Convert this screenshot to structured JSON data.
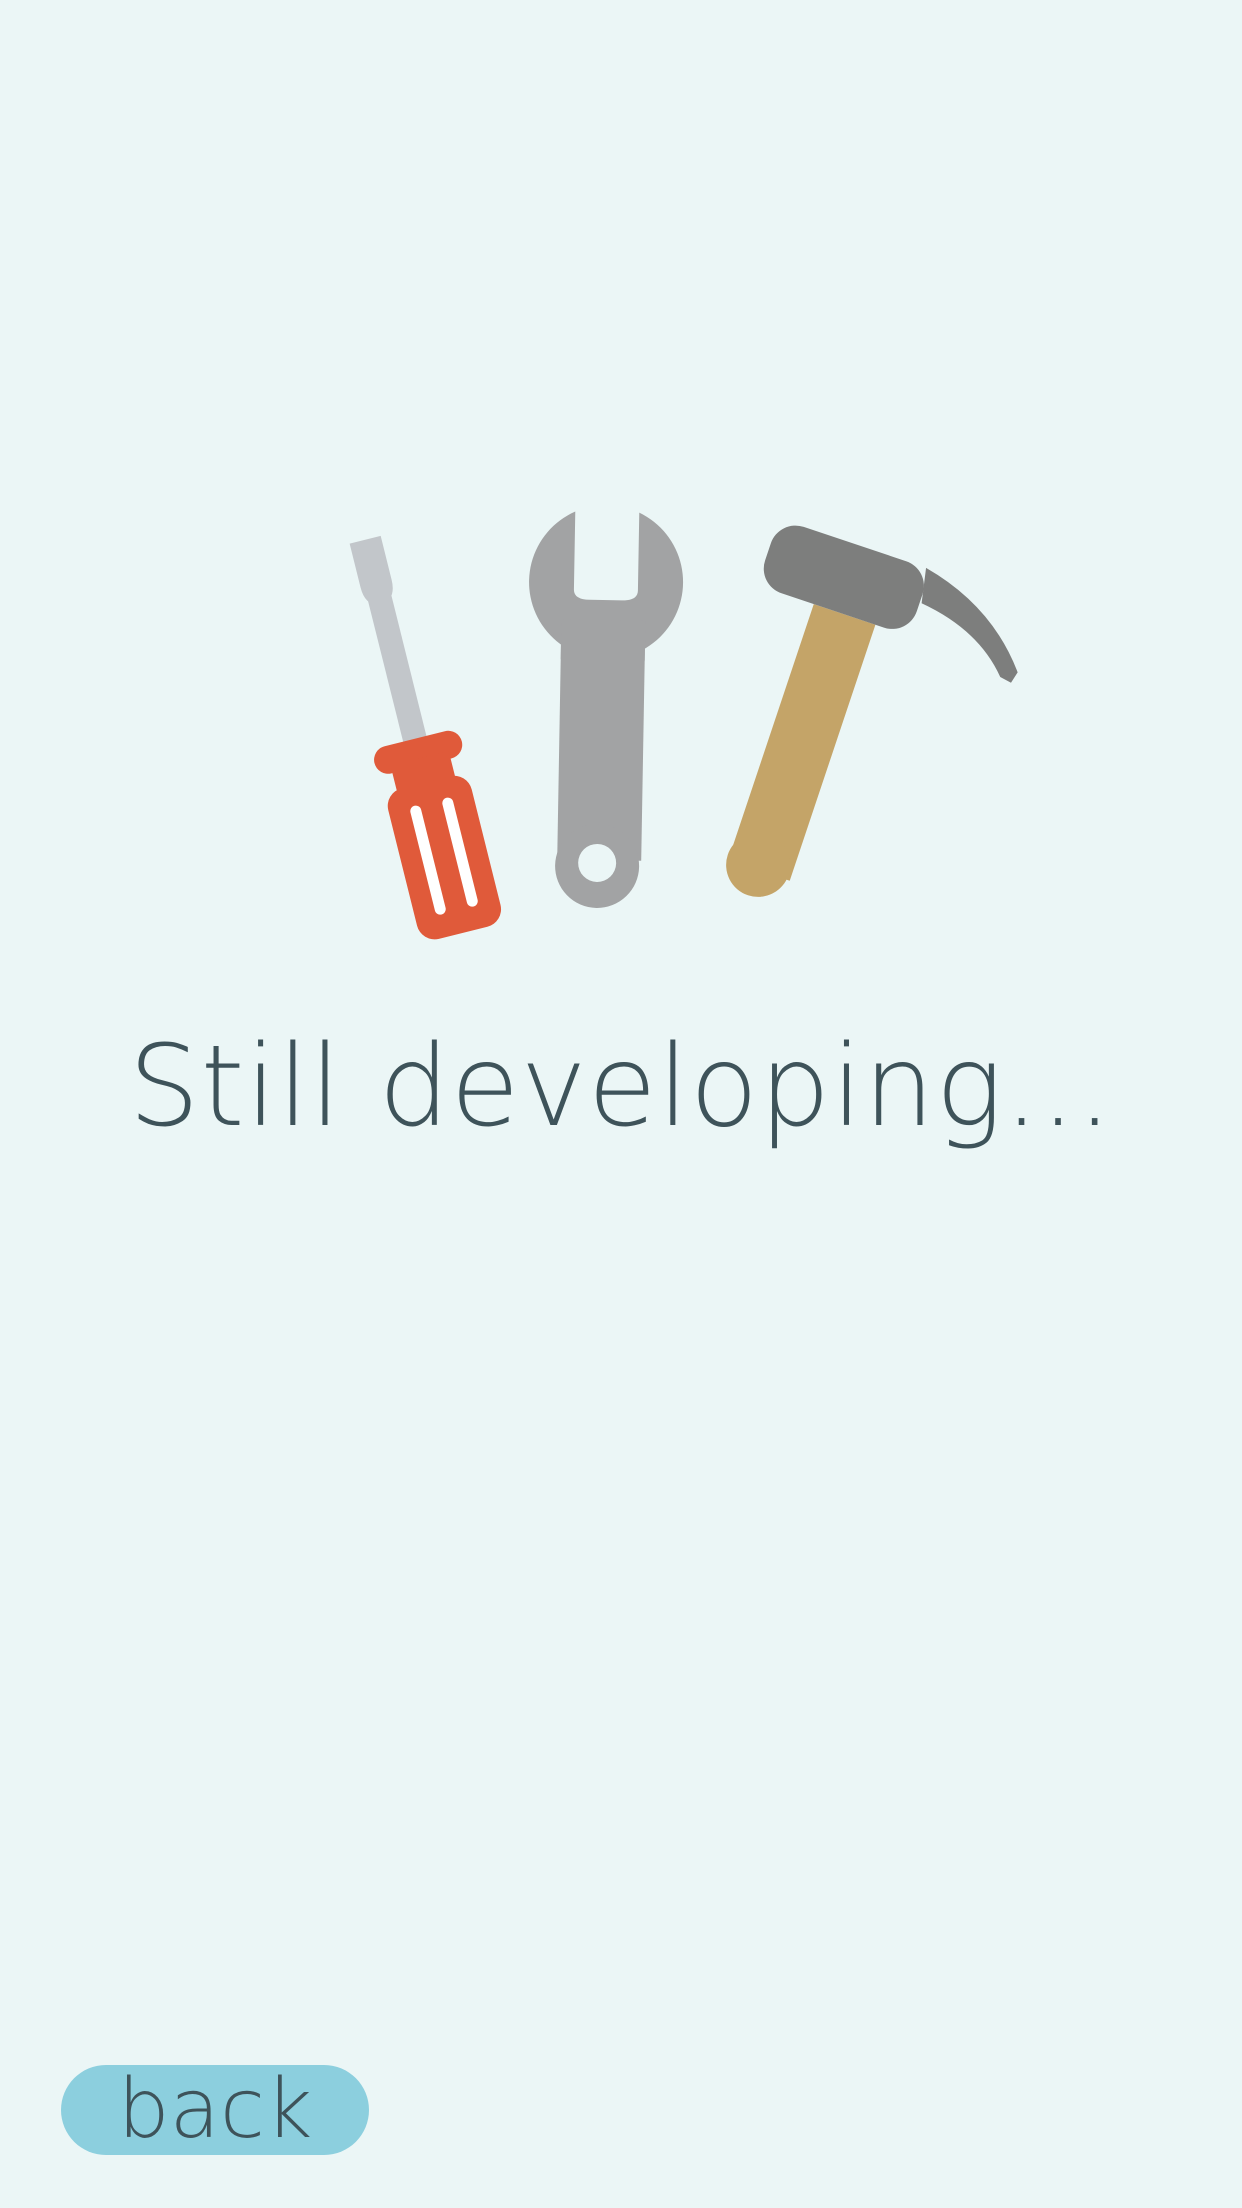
{
  "screen": {
    "message": "Still developing...",
    "back_label": "back"
  },
  "icons": {
    "screwdriver": "screwdriver-icon",
    "wrench": "wrench-icon",
    "hammer": "hammer-icon"
  },
  "colors": {
    "background": "#ebf6f6",
    "text": "#3e535a",
    "back_button": "#8ccfde",
    "screwdriver_handle": "#e05a3a",
    "screwdriver_shaft": "#c2c6ca",
    "wrench": "#a2a3a4",
    "hammer_head": "#7d7e7d",
    "hammer_handle": "#c4a468"
  }
}
